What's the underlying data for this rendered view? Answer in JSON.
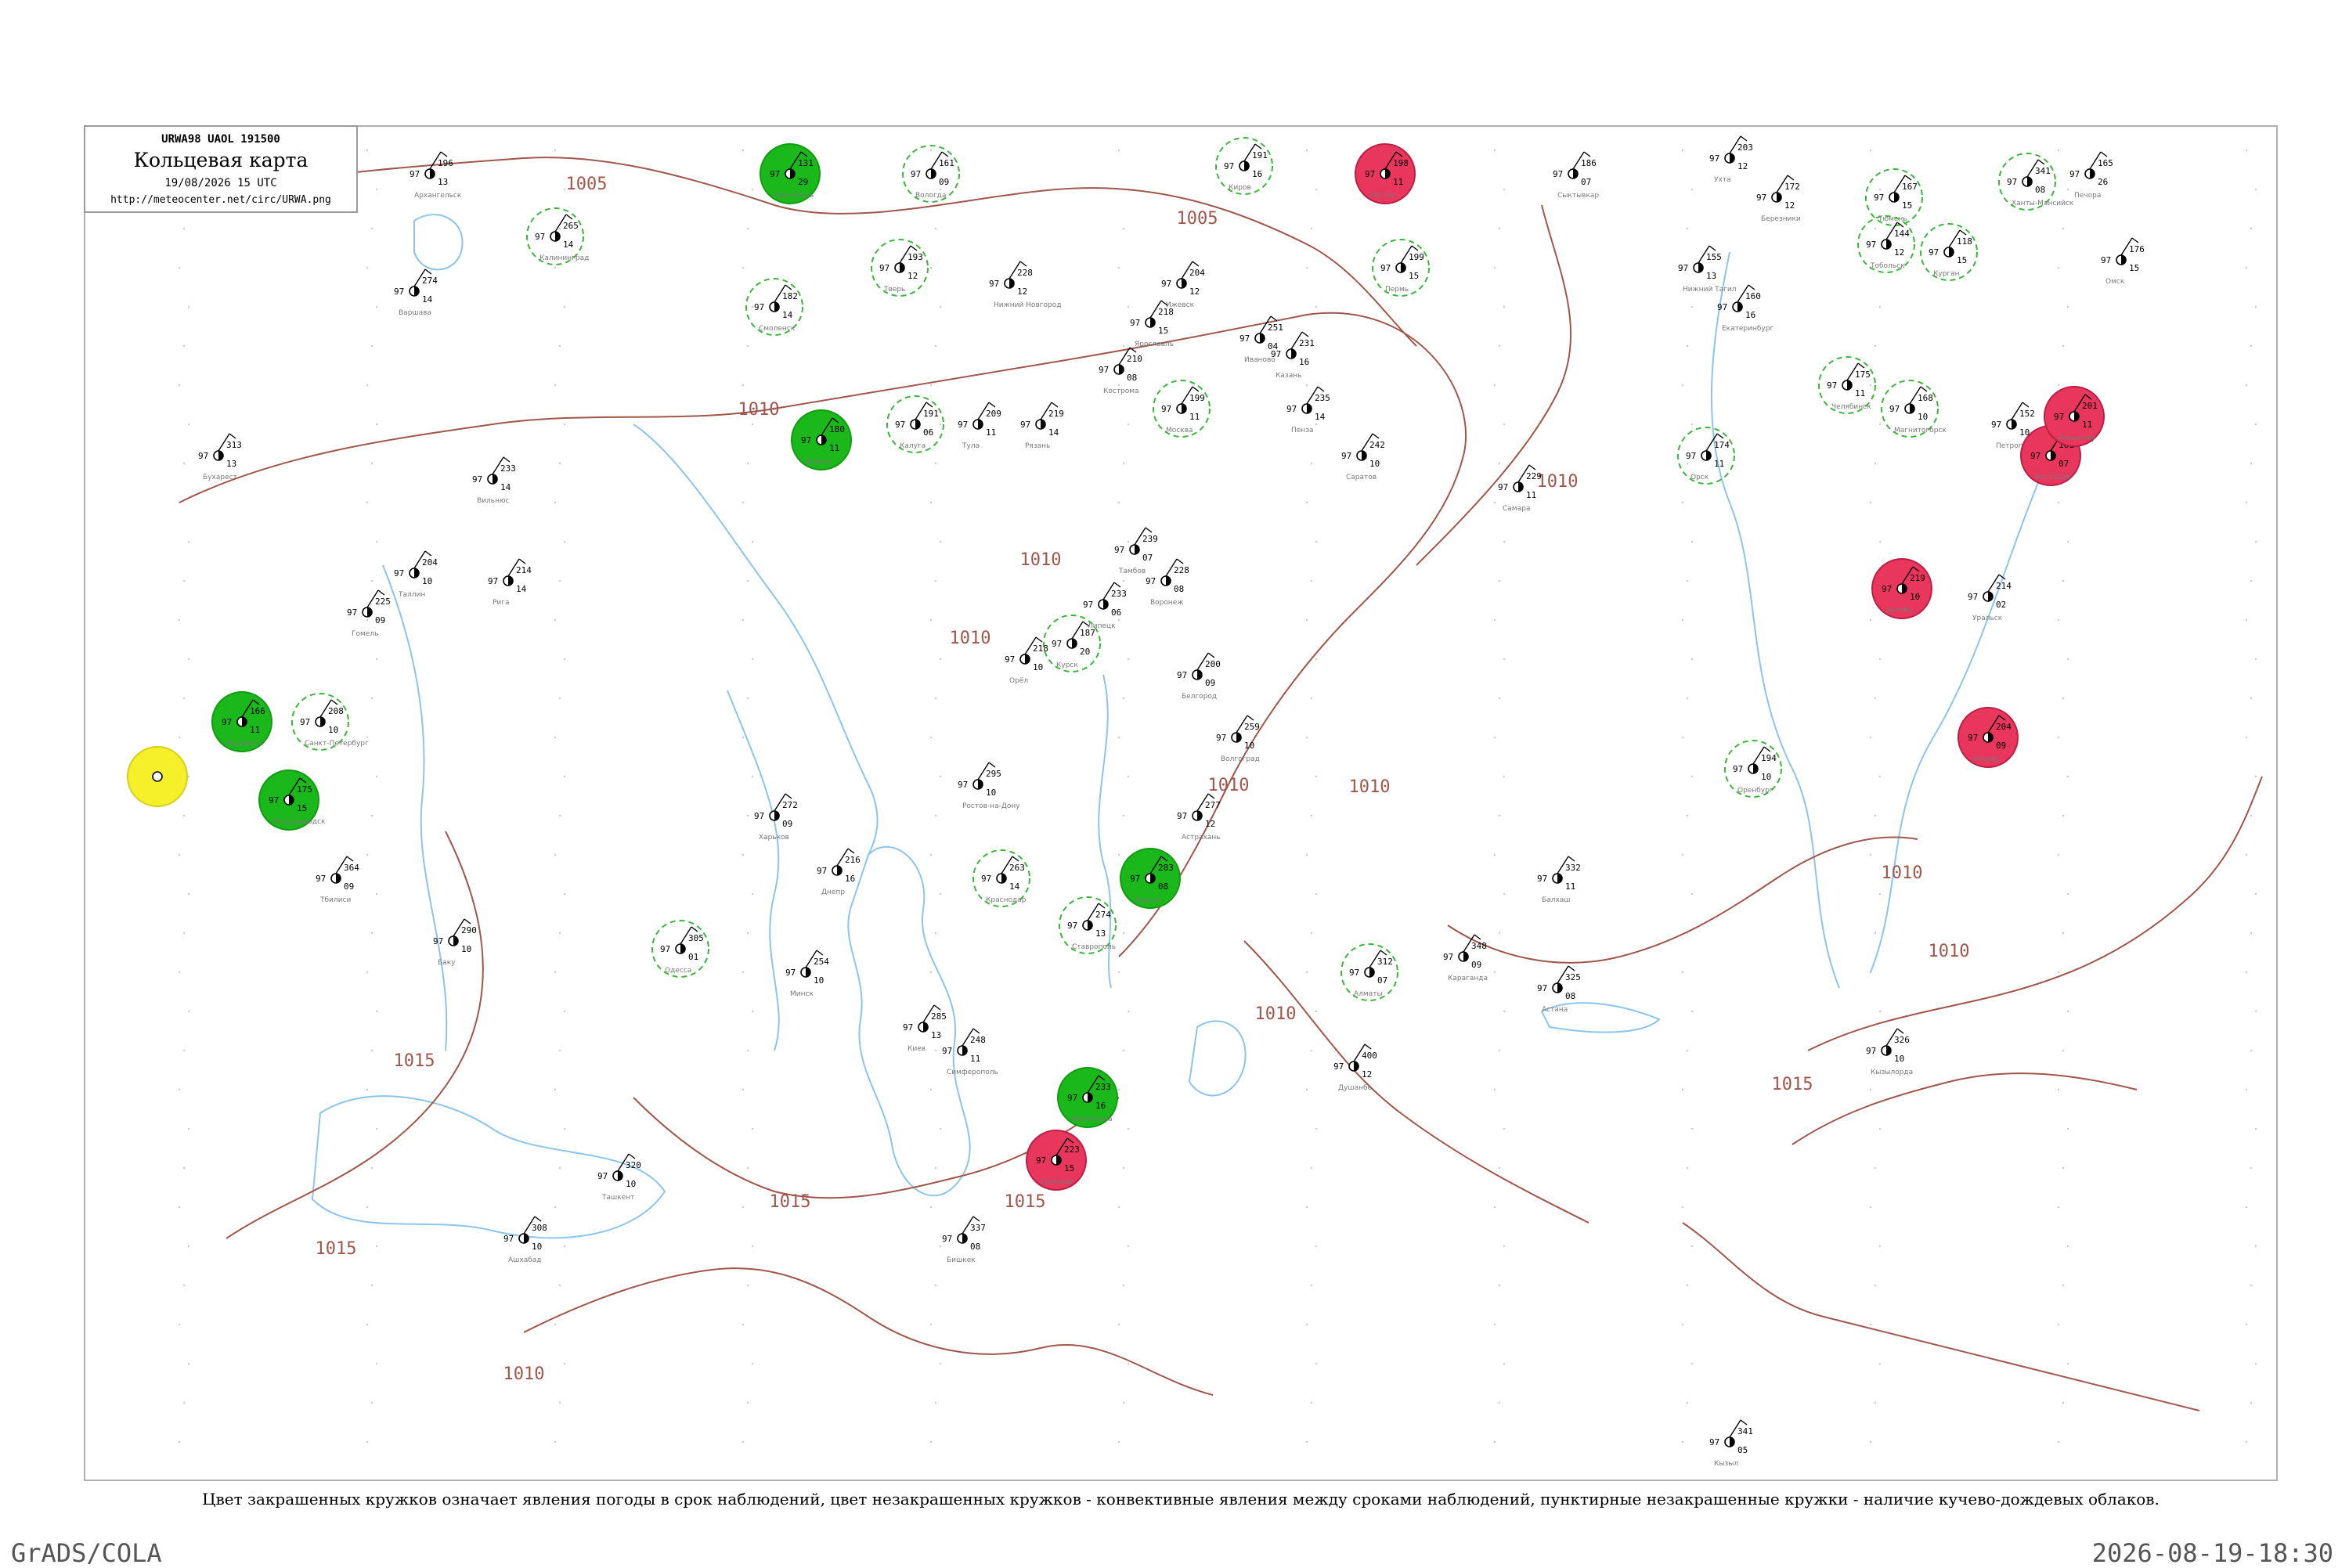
{
  "header": {
    "code": "URWA98  UAOL  191500",
    "title": "Кольцевая карта",
    "time": "19/08/2026 15 UTC",
    "url": "http://meteocenter.net/circ/URWA.png"
  },
  "caption": "Цвет закрашенных кружков означает явления погоды в срок наблюдений, цвет незакрашенных кружков - конвективные явления между сроками наблюдений, пунктирные незакрашенные кружки - наличие кучево-дождевых облаков.",
  "footer": {
    "left": "GrADS/COLA",
    "right": "2026-08-19-18:30"
  },
  "colors": {
    "rain_fill": "#1bb81b",
    "thunder_fill": "#e8365c",
    "fog_fill": "#f5f02a",
    "cb_ring": "#3cb43c",
    "thunder_ring": "#d84a78",
    "isobar": "#a0564a",
    "water": "#8cc4ee"
  },
  "isobar_labels": [
    "1005",
    "1005",
    "1010",
    "1010",
    "1010",
    "1010",
    "1010",
    "1010",
    "1010",
    "1010",
    "1010",
    "1015",
    "1015",
    "1015",
    "1015",
    "1015",
    "1010"
  ],
  "stations": [
    {
      "p": "196",
      "t": "97",
      "d": "13",
      "name": "Архангельск",
      "mark": "none"
    },
    {
      "p": "131",
      "t": "97",
      "d": "29",
      "name": "Каргополь",
      "mark": "rain"
    },
    {
      "p": "161",
      "t": "97",
      "d": "09",
      "name": "Вологда",
      "mark": "cb"
    },
    {
      "p": "191",
      "t": "97",
      "d": "16",
      "name": "Киров",
      "mark": "cb"
    },
    {
      "p": "198",
      "t": "97",
      "d": "11",
      "name": "Котлас",
      "mark": "thunder"
    },
    {
      "p": "186",
      "t": "97",
      "d": "07",
      "name": "Сыктывкар",
      "mark": "none"
    },
    {
      "p": "203",
      "t": "97",
      "d": "12",
      "name": "Ухта",
      "mark": "none"
    },
    {
      "p": "165",
      "t": "97",
      "d": "26",
      "name": "Печора",
      "mark": "none"
    },
    {
      "p": "199",
      "t": "97",
      "d": "15",
      "name": "Пермь",
      "mark": "cb"
    },
    {
      "p": "172",
      "t": "97",
      "d": "12",
      "name": "Березники",
      "mark": "none"
    },
    {
      "p": "167",
      "t": "97",
      "d": "15",
      "name": "Тюмень",
      "mark": "cb"
    },
    {
      "p": "341",
      "t": "97",
      "d": "08",
      "name": "Ханты-Мансийск",
      "mark": "cb"
    },
    {
      "p": "144",
      "t": "97",
      "d": "12",
      "name": "Тобольск",
      "mark": "cb"
    },
    {
      "p": "118",
      "t": "97",
      "d": "15",
      "name": "Курган",
      "mark": "cb"
    },
    {
      "p": "176",
      "t": "97",
      "d": "15",
      "name": "Омск",
      "mark": "none"
    },
    {
      "p": "155",
      "t": "97",
      "d": "13",
      "name": "Нижний Тагил",
      "mark": "none"
    },
    {
      "p": "160",
      "t": "97",
      "d": "16",
      "name": "Екатеринбург",
      "mark": "none"
    },
    {
      "p": "175",
      "t": "97",
      "d": "11",
      "name": "Челябинск",
      "mark": "cb"
    },
    {
      "p": "168",
      "t": "97",
      "d": "10",
      "name": "Магнитогорск",
      "mark": "cb"
    },
    {
      "p": "174",
      "t": "97",
      "d": "11",
      "name": "Орск",
      "mark": "cb"
    },
    {
      "p": "152",
      "t": "97",
      "d": "10",
      "name": "Петропавловск",
      "mark": "none"
    },
    {
      "p": "161",
      "t": "97",
      "d": "07",
      "name": "Костанай",
      "mark": "thunder"
    },
    {
      "p": "201",
      "t": "97",
      "d": "11",
      "name": "Кокшетау",
      "mark": "thunder"
    },
    {
      "p": "219",
      "t": "97",
      "d": "10",
      "name": "Актобе",
      "mark": "thunder"
    },
    {
      "p": "214",
      "t": "97",
      "d": "02",
      "name": "Уральск",
      "mark": "none"
    },
    {
      "p": "204",
      "t": "97",
      "d": "09",
      "name": "Атырау",
      "mark": "thunder"
    },
    {
      "p": "194",
      "t": "97",
      "d": "10",
      "name": "Оренбург",
      "mark": "cb"
    },
    {
      "p": "229",
      "t": "97",
      "d": "11",
      "name": "Самара",
      "mark": "none"
    },
    {
      "p": "242",
      "t": "97",
      "d": "10",
      "name": "Саратов",
      "mark": "none"
    },
    {
      "p": "235",
      "t": "97",
      "d": "14",
      "name": "Пенза",
      "mark": "none"
    },
    {
      "p": "231",
      "t": "97",
      "d": "16",
      "name": "Казань",
      "mark": "none"
    },
    {
      "p": "204",
      "t": "97",
      "d": "12",
      "name": "Ижевск",
      "mark": "none"
    },
    {
      "p": "228",
      "t": "97",
      "d": "12",
      "name": "Нижний Новгород",
      "mark": "none"
    },
    {
      "p": "218",
      "t": "97",
      "d": "15",
      "name": "Ярославль",
      "mark": "none"
    },
    {
      "p": "210",
      "t": "97",
      "d": "08",
      "name": "Кострома",
      "mark": "none"
    },
    {
      "p": "251",
      "t": "97",
      "d": "04",
      "name": "Иваново",
      "mark": "none"
    },
    {
      "p": "199",
      "t": "97",
      "d": "11",
      "name": "Москва",
      "mark": "cb"
    },
    {
      "p": "193",
      "t": "97",
      "d": "12",
      "name": "Тверь",
      "mark": "cb"
    },
    {
      "p": "182",
      "t": "97",
      "d": "14",
      "name": "Смоленск",
      "mark": "cb"
    },
    {
      "p": "180",
      "t": "97",
      "d": "11",
      "name": "Брянск",
      "mark": "rain"
    },
    {
      "p": "191",
      "t": "97",
      "d": "06",
      "name": "Калуга",
      "mark": "cb"
    },
    {
      "p": "209",
      "t": "97",
      "d": "11",
      "name": "Тула",
      "mark": "none"
    },
    {
      "p": "219",
      "t": "97",
      "d": "14",
      "name": "Рязань",
      "mark": "none"
    },
    {
      "p": "239",
      "t": "97",
      "d": "07",
      "name": "Тамбов",
      "mark": "none"
    },
    {
      "p": "233",
      "t": "97",
      "d": "06",
      "name": "Липецк",
      "mark": "none"
    },
    {
      "p": "228",
      "t": "97",
      "d": "08",
      "name": "Воронеж",
      "mark": "none"
    },
    {
      "p": "187",
      "t": "97",
      "d": "20",
      "name": "Курск",
      "mark": "cb"
    },
    {
      "p": "200",
      "t": "97",
      "d": "09",
      "name": "Белгород",
      "mark": "none"
    },
    {
      "p": "218",
      "t": "97",
      "d": "10",
      "name": "Орёл",
      "mark": "none"
    },
    {
      "p": "259",
      "t": "97",
      "d": "10",
      "name": "Волгоград",
      "mark": "none"
    },
    {
      "p": "277",
      "t": "97",
      "d": "12",
      "name": "Астрахань",
      "mark": "none"
    },
    {
      "p": "283",
      "t": "97",
      "d": "08",
      "name": "Элиста",
      "mark": "rain"
    },
    {
      "p": "295",
      "t": "97",
      "d": "10",
      "name": "Ростов-на-Дону",
      "mark": "none"
    },
    {
      "p": "263",
      "t": "97",
      "d": "14",
      "name": "Краснодар",
      "mark": "cb"
    },
    {
      "p": "274",
      "t": "97",
      "d": "13",
      "name": "Ставрополь",
      "mark": "cb"
    },
    {
      "p": "233",
      "t": "97",
      "d": "16",
      "name": "Махачкала",
      "mark": "rain"
    },
    {
      "p": "223",
      "t": "97",
      "d": "15",
      "name": "Грозный",
      "mark": "thunder"
    },
    {
      "p": "248",
      "t": "97",
      "d": "11",
      "name": "Симферополь",
      "mark": "none"
    },
    {
      "p": "305",
      "t": "97",
      "d": "01",
      "name": "Одесса",
      "mark": "cb"
    },
    {
      "p": "285",
      "t": "97",
      "d": "13",
      "name": "Киев",
      "mark": "none"
    },
    {
      "p": "272",
      "t": "97",
      "d": "09",
      "name": "Харьков",
      "mark": "none"
    },
    {
      "p": "216",
      "t": "97",
      "d": "16",
      "name": "Днепр",
      "mark": "none"
    },
    {
      "p": "254",
      "t": "97",
      "d": "10",
      "name": "Минск",
      "mark": "none"
    },
    {
      "p": "225",
      "t": "97",
      "d": "09",
      "name": "Гомель",
      "mark": "none"
    },
    {
      "p": "233",
      "t": "97",
      "d": "14",
      "name": "Вильнюс",
      "mark": "none"
    },
    {
      "p": "214",
      "t": "97",
      "d": "14",
      "name": "Рига",
      "mark": "none"
    },
    {
      "p": "204",
      "t": "97",
      "d": "10",
      "name": "Таллин",
      "mark": "none"
    },
    {
      "p": "208",
      "t": "97",
      "d": "10",
      "name": "Санкт-Петербург",
      "mark": "cb"
    },
    {
      "p": "175",
      "t": "97",
      "d": "15",
      "name": "Петрозаводск",
      "mark": "rain"
    },
    {
      "p": "166",
      "t": "97",
      "d": "11",
      "name": "Мурманск",
      "mark": "rain"
    },
    {
      "p": "265",
      "t": "97",
      "d": "14",
      "name": "Калининград",
      "mark": "cb"
    },
    {
      "p": "274",
      "t": "97",
      "d": "14",
      "name": "Варшава",
      "mark": "none"
    },
    {
      "p": "313",
      "t": "97",
      "d": "13",
      "name": "Бухарест",
      "mark": "none"
    },
    {
      "p": "364",
      "t": "97",
      "d": "09",
      "name": "Тбилиси",
      "mark": "none"
    },
    {
      "p": "290",
      "t": "97",
      "d": "10",
      "name": "Баку",
      "mark": "none"
    },
    {
      "p": "308",
      "t": "97",
      "d": "10",
      "name": "Ашхабад",
      "mark": "none"
    },
    {
      "p": "320",
      "t": "97",
      "d": "10",
      "name": "Ташкент",
      "mark": "none"
    },
    {
      "p": "337",
      "t": "97",
      "d": "08",
      "name": "Бишкек",
      "mark": "none"
    },
    {
      "p": "312",
      "t": "97",
      "d": "07",
      "name": "Алматы",
      "mark": "cb"
    },
    {
      "p": "326",
      "t": "97",
      "d": "10",
      "name": "Кызылорда",
      "mark": "none"
    },
    {
      "p": "332",
      "t": "97",
      "d": "11",
      "name": "Балхаш",
      "mark": "none"
    },
    {
      "p": "348",
      "t": "97",
      "d": "09",
      "name": "Караганда",
      "mark": "none"
    },
    {
      "p": "325",
      "t": "97",
      "d": "08",
      "name": "Астана",
      "mark": "none"
    },
    {
      "p": "400",
      "t": "97",
      "d": "12",
      "name": "Душанбе",
      "mark": "none"
    },
    {
      "p": "341",
      "t": "97",
      "d": "05",
      "name": "Кызыл",
      "mark": "none"
    }
  ]
}
